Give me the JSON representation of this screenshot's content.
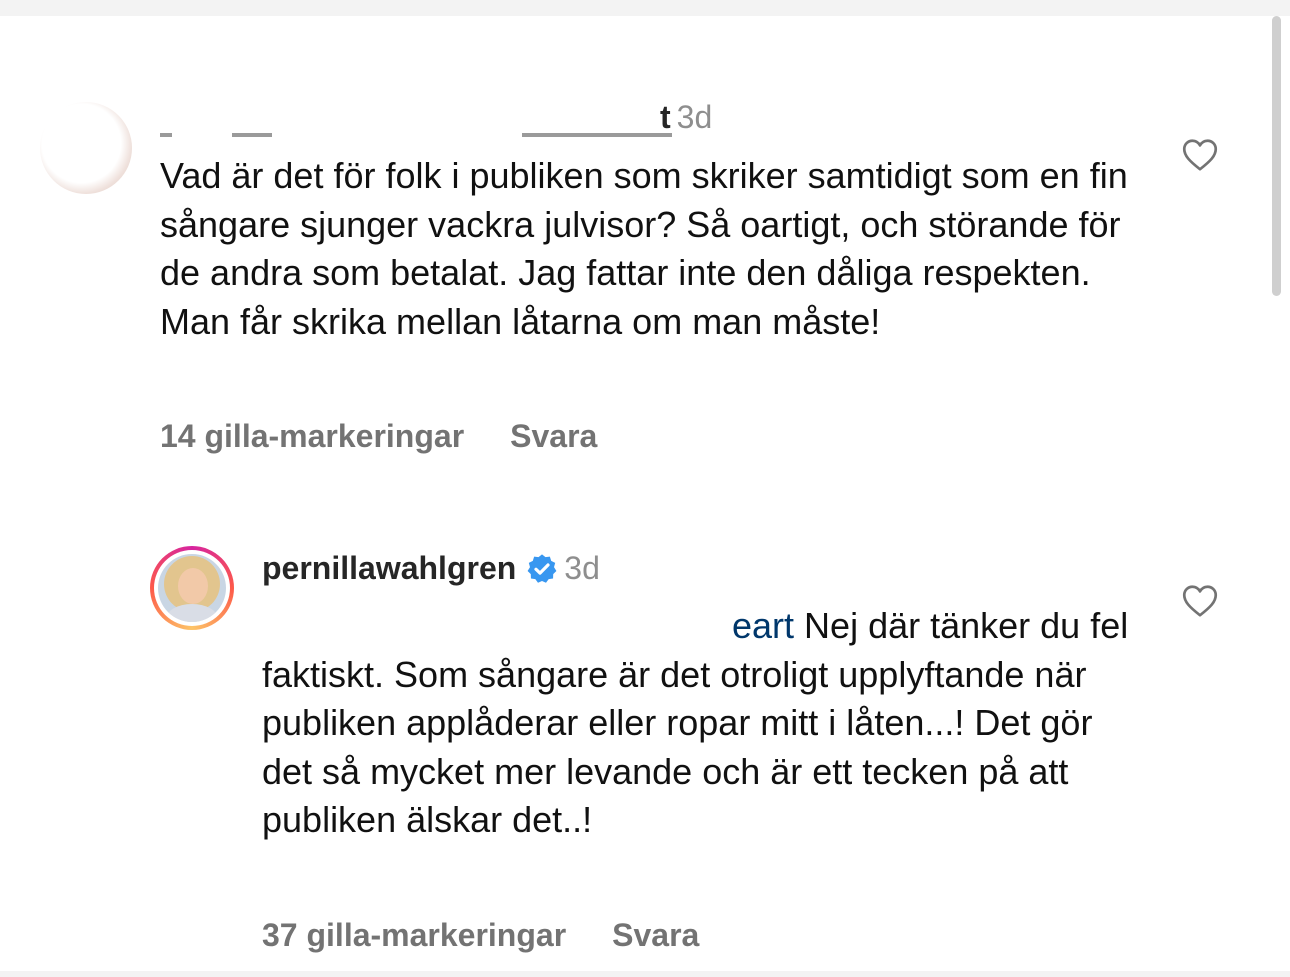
{
  "comments": [
    {
      "username": "t",
      "time": "3d",
      "text": "Vad är det för folk i publiken som skriker samtidigt som en fin sångare sjunger vackra julvisor? Så oartigt, och störande för de andra som betalat. Jag fattar inte den dåliga respekten. Man får skrika mellan låtarna om man måste!",
      "likes": "14 gilla-markeringar",
      "reply": "Svara",
      "like_icon": "heart-outline-icon"
    },
    {
      "username": "pernillawahlgren",
      "verified_icon": "verified-badge-icon",
      "time": "3d",
      "mention": "eart",
      "text": " Nej där tänker du fel faktiskt. Som sångare är det otroligt upplyftande när publiken applåderar eller ropar mitt i låten...! Det gör det så mycket mer levande och är ett tecken på att publiken älskar det..!",
      "likes": "37 gilla-markeringar",
      "reply": "Svara",
      "like_icon": "heart-outline-icon"
    }
  ],
  "colors": {
    "verified": "#3897f0",
    "mention": "#00376b",
    "muted": "#737373"
  }
}
